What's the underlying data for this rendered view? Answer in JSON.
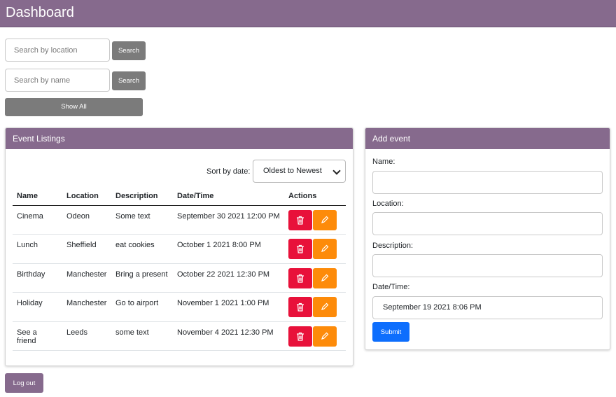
{
  "header": {
    "title": "Dashboard"
  },
  "search": {
    "location_placeholder": "Search by location",
    "location_button": "Search",
    "name_placeholder": "Search by name",
    "name_button": "Search",
    "show_all": "Show All"
  },
  "listings": {
    "title": "Event Listings",
    "sort_label": "Sort by date:",
    "sort_value": "Oldest to Newest",
    "columns": [
      "Name",
      "Location",
      "Description",
      "Date/Time",
      "Actions"
    ],
    "rows": [
      {
        "name": "Cinema",
        "location": "Odeon",
        "description": "Some text",
        "datetime": "September 30 2021 12:00 PM"
      },
      {
        "name": "Lunch",
        "location": "Sheffield",
        "description": "eat cookies",
        "datetime": "October 1 2021 8:00 PM"
      },
      {
        "name": "Birthday",
        "location": "Manchester",
        "description": "Bring a present",
        "datetime": "October 22 2021 12:30 PM"
      },
      {
        "name": "Holiday",
        "location": "Manchester",
        "description": "Go to airport",
        "datetime": "November 1 2021 1:00 PM"
      },
      {
        "name": "See a friend",
        "location": "Leeds",
        "description": "some text",
        "datetime": "November 4 2021 12:30 PM"
      }
    ]
  },
  "add_event": {
    "title": "Add event",
    "name_label": "Name:",
    "name_value": "",
    "location_label": "Location:",
    "location_value": "",
    "description_label": "Description:",
    "description_value": "",
    "datetime_label": "Date/Time:",
    "datetime_value": "September 19 2021 8:06 PM",
    "submit": "Submit"
  },
  "logout": "Log out",
  "colors": {
    "brand": "#866a8d",
    "delete": "#e8113a",
    "edit": "#fd8b0a",
    "submit": "#0d6efd",
    "neutral_button": "#7b7b7b"
  },
  "icons": {
    "delete": "trash-icon",
    "edit": "pencil-icon"
  }
}
